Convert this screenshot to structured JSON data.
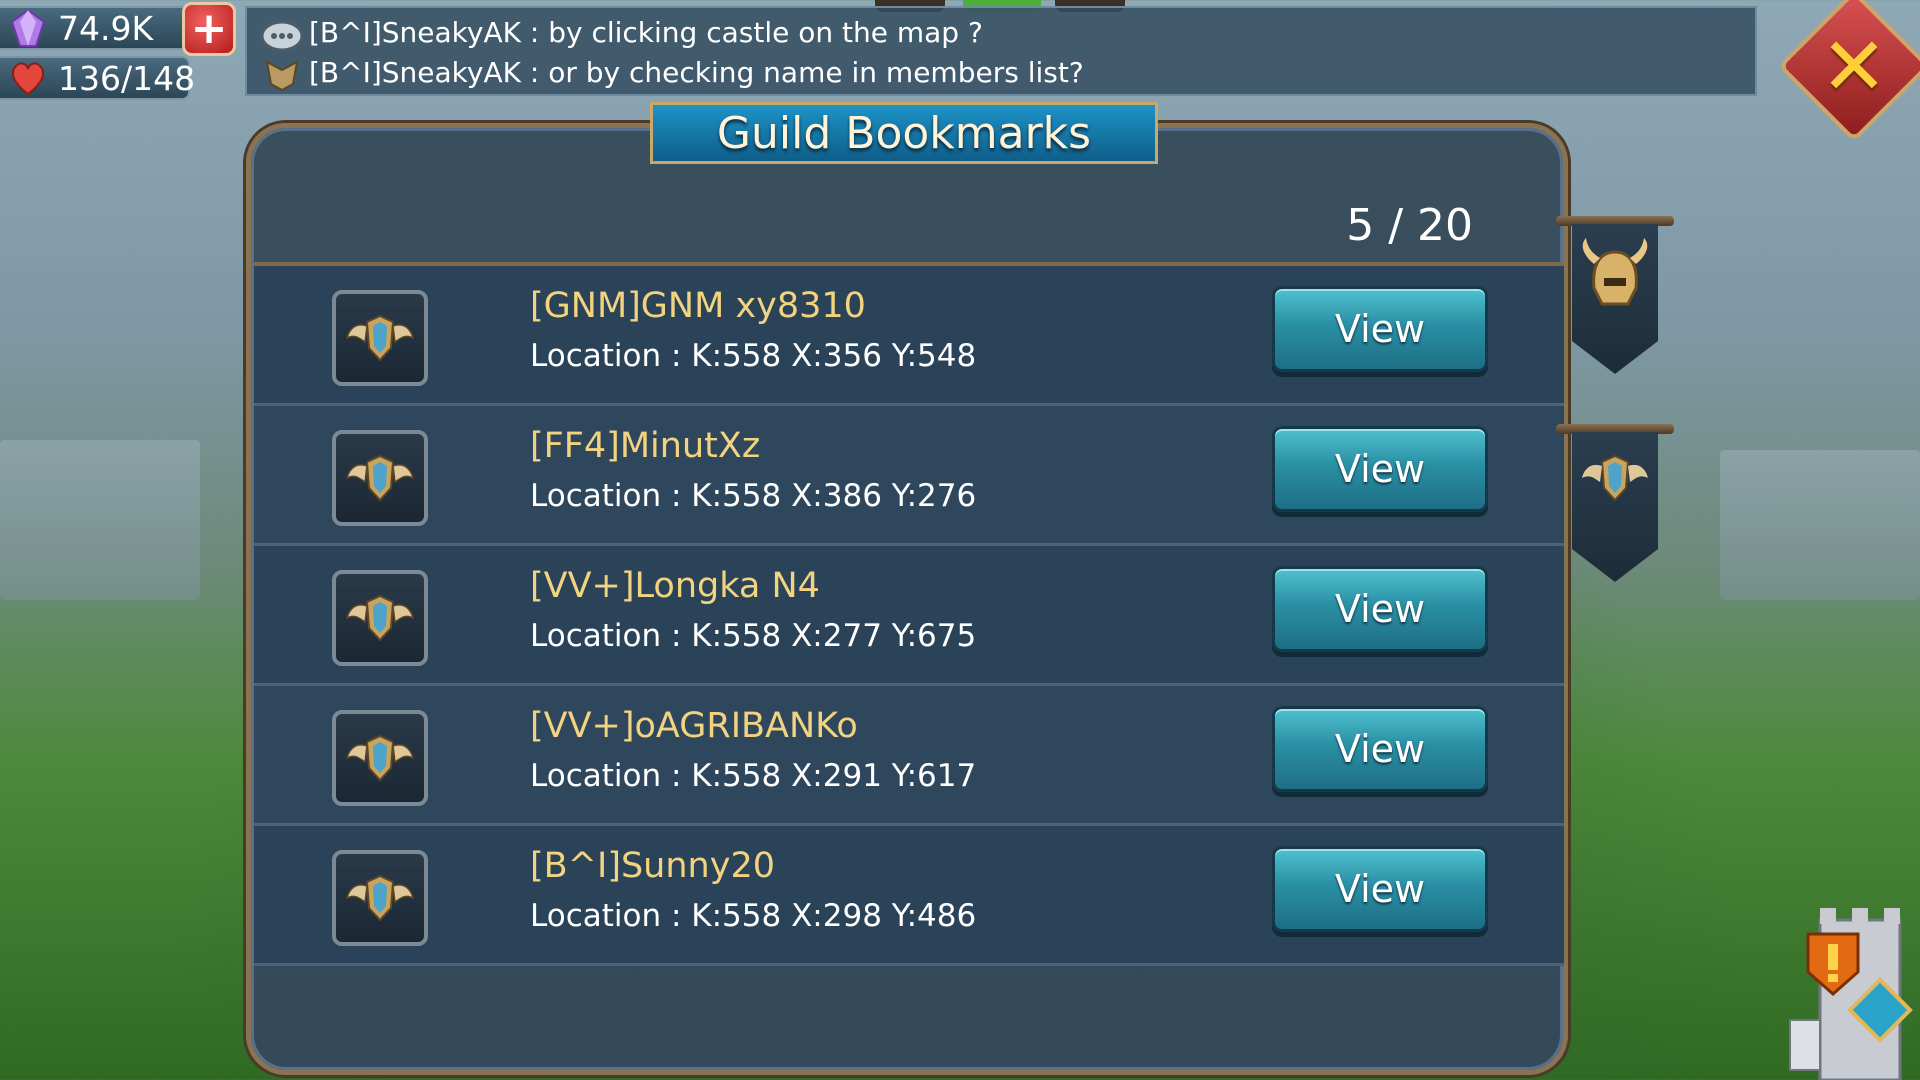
{
  "resources": {
    "gems": "74.9K",
    "stamina": "136/148"
  },
  "chat": {
    "lines": [
      "[B^I]SneakyAK : by clicking castle on the map ?",
      "[B^I]SneakyAK : or by checking name in members list?"
    ]
  },
  "dialog": {
    "title": "Guild Bookmarks",
    "count": "5 / 20",
    "view_label": "View",
    "bookmarks": [
      {
        "name": "[GNM]GNM xy8310",
        "location": "Location : K:558 X:356 Y:548"
      },
      {
        "name": "[FF4]MinutXz",
        "location": "Location : K:558 X:386 Y:276"
      },
      {
        "name": "[VV+]Longka N4",
        "location": "Location : K:558 X:277 Y:675"
      },
      {
        "name": "[VV+]oAGRIBANKo",
        "location": "Location : K:558 X:291 Y:617"
      },
      {
        "name": "[B^I]Sunny20",
        "location": "Location : K:558 X:298 Y:486"
      }
    ]
  },
  "colors": {
    "name_gold": "#f2d37f",
    "button_teal": "#2a8fa4",
    "panel_border": "#8a7352"
  },
  "icons": [
    "gem-icon",
    "heart-icon",
    "plus-icon",
    "chat-bubble-icon",
    "guild-crest-icon",
    "close-icon",
    "helmet-icon",
    "wings-shield-icon",
    "alert-icon",
    "tower-icon"
  ]
}
